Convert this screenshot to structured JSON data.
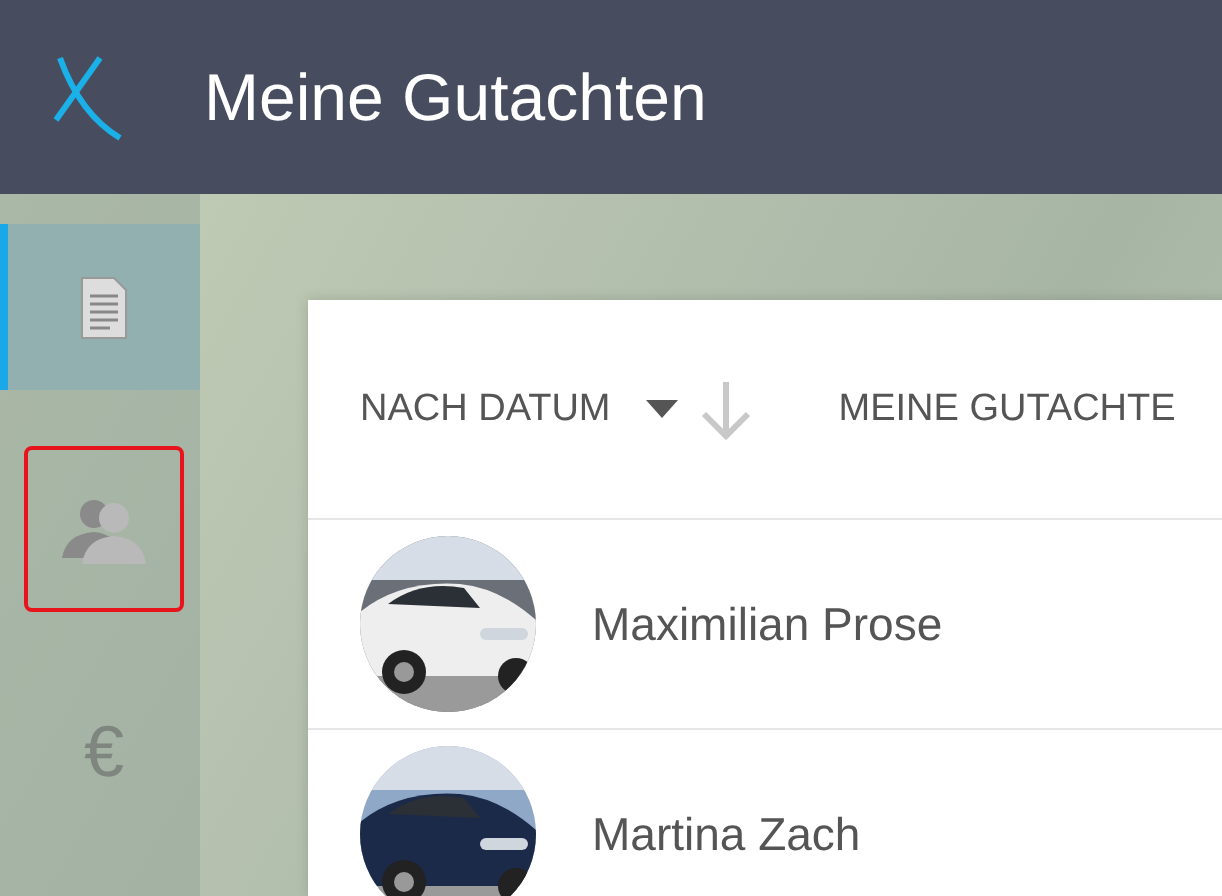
{
  "header": {
    "title": "Meine Gutachten"
  },
  "sidebar": {
    "items": [
      {
        "kind": "document",
        "selected": true,
        "highlighted": false
      },
      {
        "kind": "contacts",
        "selected": false,
        "highlighted": true
      },
      {
        "kind": "euro",
        "selected": false,
        "highlighted": false,
        "glyph": "€"
      }
    ]
  },
  "toolbar": {
    "sort": {
      "label": "NACH DATUM",
      "descending": true
    },
    "filter": {
      "label": "MEINE GUTACHTE"
    }
  },
  "reports": [
    {
      "name": "Maximilian Prose"
    },
    {
      "name": "Martina Zach"
    }
  ]
}
